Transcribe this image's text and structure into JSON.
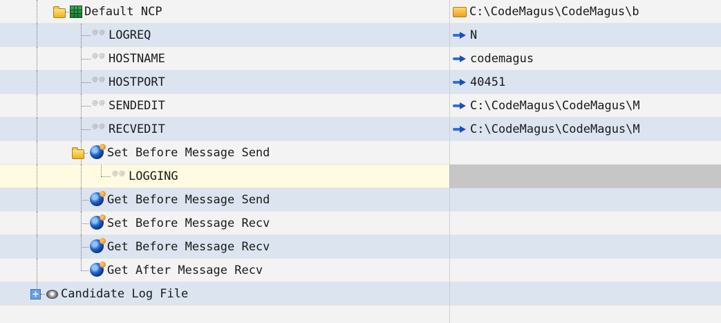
{
  "rows": [
    {
      "label": "Default NCP",
      "value": "C:\\CodeMagus\\CodeMagus\\b"
    },
    {
      "label": "LOGREQ",
      "value": "N"
    },
    {
      "label": "HOSTNAME",
      "value": "codemagus"
    },
    {
      "label": "HOSTPORT",
      "value": "40451"
    },
    {
      "label": "SENDEDIT",
      "value": "C:\\CodeMagus\\CodeMagus\\M"
    },
    {
      "label": "RECVEDIT",
      "value": "C:\\CodeMagus\\CodeMagus\\M"
    },
    {
      "label": "Set Before Message Send",
      "value": ""
    },
    {
      "label": "LOGGING",
      "value": ""
    },
    {
      "label": "Get Before Message Send",
      "value": ""
    },
    {
      "label": "Set Before Message Recv",
      "value": ""
    },
    {
      "label": "Get Before Message Recv",
      "value": ""
    },
    {
      "label": "Get After Message Recv",
      "value": ""
    },
    {
      "label": "Candidate Log File",
      "value": ""
    }
  ],
  "expanders": {
    "collapsed": "+",
    "expanded": "-"
  },
  "param_icon_text": "@@"
}
